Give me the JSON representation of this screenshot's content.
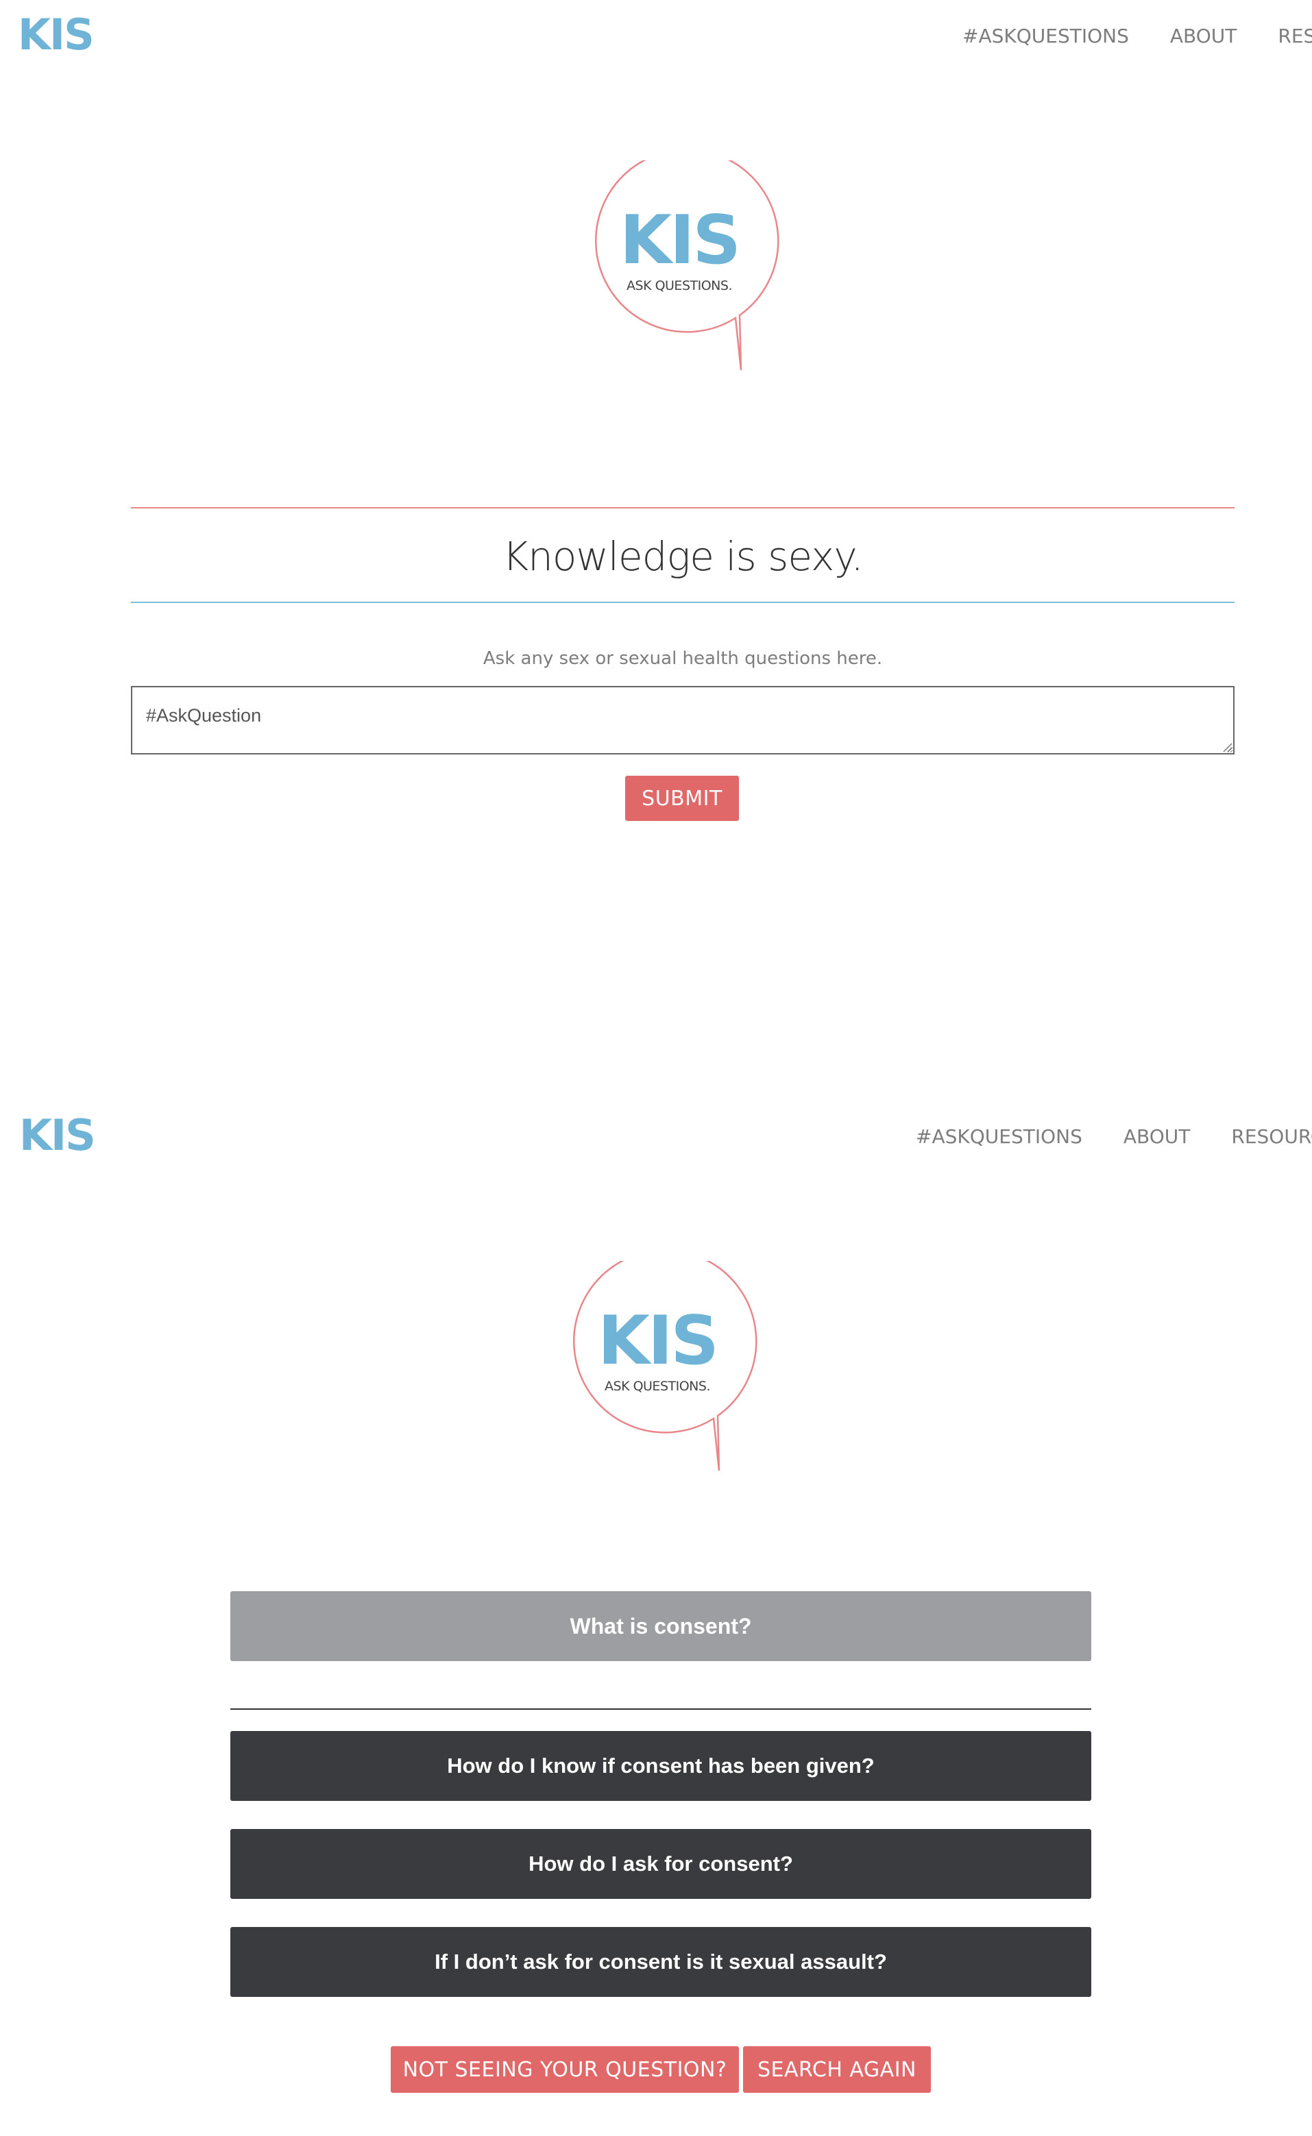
{
  "brand": {
    "nav_logo": "KIS",
    "badge_logo": "KIS",
    "badge_tagline": "ASK QUESTIONS.",
    "primary_color": "#6fb3d6",
    "accent_color": "#e06868"
  },
  "screen1": {
    "nav": [
      "#ASKQUESTIONS",
      "ABOUT",
      "RESOUR"
    ],
    "headline": "Knowledge is sexy.",
    "subtitle": "Ask any sex or sexual health questions here.",
    "ask_input": {
      "value": "",
      "placeholder": "#AskQuestion"
    },
    "submit_label": "SUBMIT"
  },
  "screen2": {
    "nav": [
      "#ASKQUESTIONS",
      "ABOUT",
      "RESOURCES"
    ],
    "selected_question": "What is consent?",
    "related_questions": [
      "How do I know if consent has been given?",
      "How do I ask for consent?",
      "If I don’t ask for consent is it sexual assault?"
    ],
    "not_seeing_label": "NOT SEEING YOUR QUESTION?",
    "search_again_label": "SEARCH AGAIN"
  },
  "icons": [
    "speech-bubble-icon",
    "resize-grip-icon"
  ]
}
